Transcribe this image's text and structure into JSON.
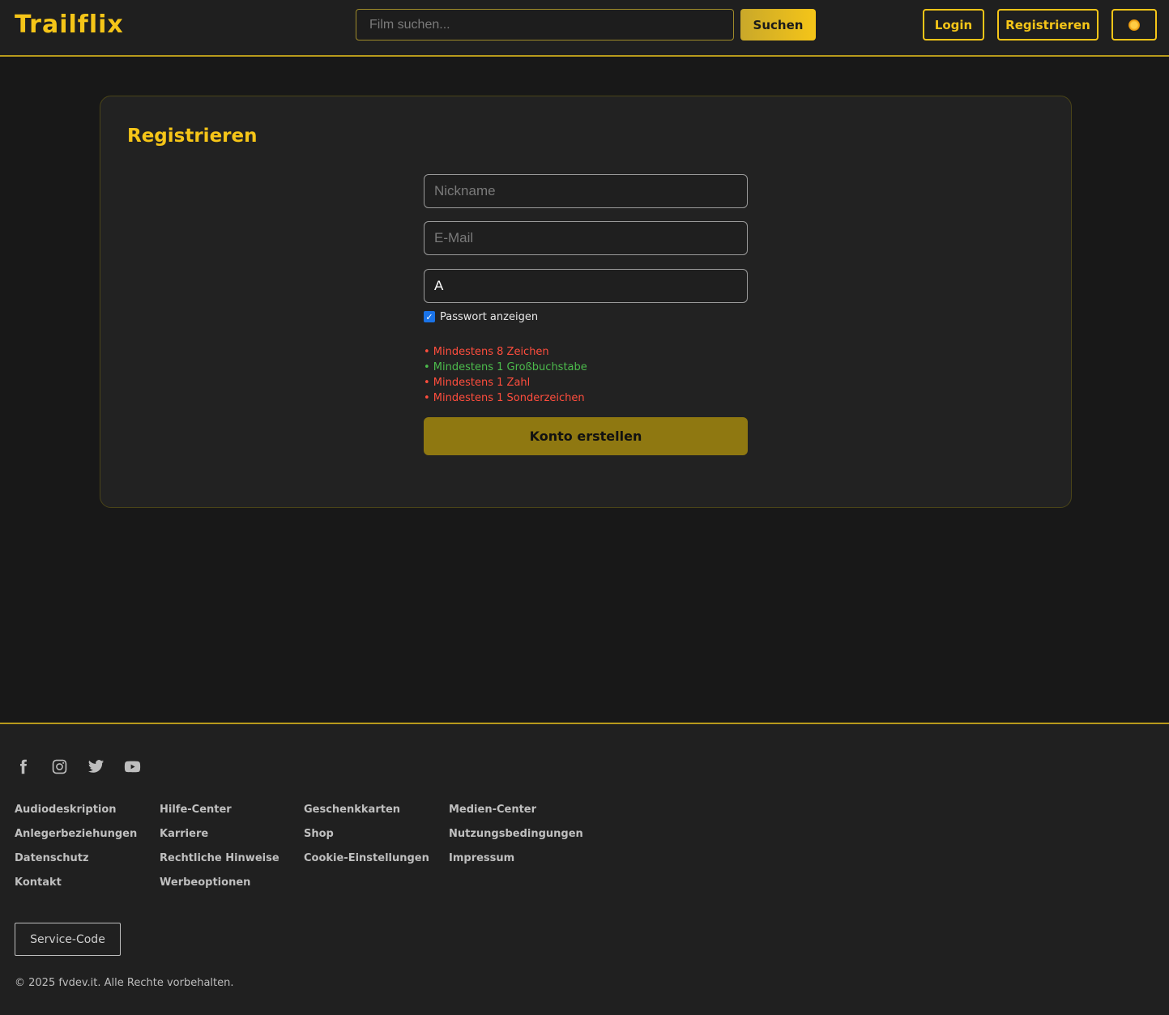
{
  "header": {
    "logo": "Trailflix",
    "search_placeholder": "Film suchen...",
    "search_label": "Suchen",
    "login_label": "Login",
    "register_label": "Registrieren",
    "theme_icon": "sun-icon"
  },
  "form": {
    "title": "Registrieren",
    "nickname_placeholder": "Nickname",
    "email_placeholder": "E-Mail",
    "password_value": "A",
    "show_password_label": "Passwort anzeigen",
    "show_password_checked": true,
    "rules": [
      {
        "text": "• Mindestens 8 Zeichen",
        "status": "fail",
        "color": "#ff4d3d"
      },
      {
        "text": "• Mindestens 1 Großbuchstabe",
        "status": "pass",
        "color": "#4cbb4c"
      },
      {
        "text": "• Mindestens 1 Zahl",
        "status": "fail",
        "color": "#ff4d3d"
      },
      {
        "text": "• Mindestens 1 Sonderzeichen",
        "status": "fail",
        "color": "#ff4d3d"
      }
    ],
    "submit_label": "Konto erstellen"
  },
  "footer": {
    "socials": [
      "facebook-icon",
      "instagram-icon",
      "twitter-icon",
      "youtube-icon"
    ],
    "link_columns": [
      [
        "Audiodeskription",
        "Anlegerbeziehungen",
        "Datenschutz",
        "Kontakt"
      ],
      [
        "Hilfe-Center",
        "Karriere",
        "Rechtliche Hinweise",
        "Werbeoptionen"
      ],
      [
        "Geschenkkarten",
        "Shop",
        "Cookie-Einstellungen"
      ],
      [
        "Medien-Center",
        "Nutzungsbedingungen",
        "Impressum"
      ]
    ],
    "service_code_label": "Service-Code",
    "copyright": "© 2025 fvdev.it. Alle Rechte vorbehalten."
  },
  "colors": {
    "accent": "#f5c518",
    "background": "#181818",
    "card": "#222222",
    "submit": "#8f7811"
  }
}
